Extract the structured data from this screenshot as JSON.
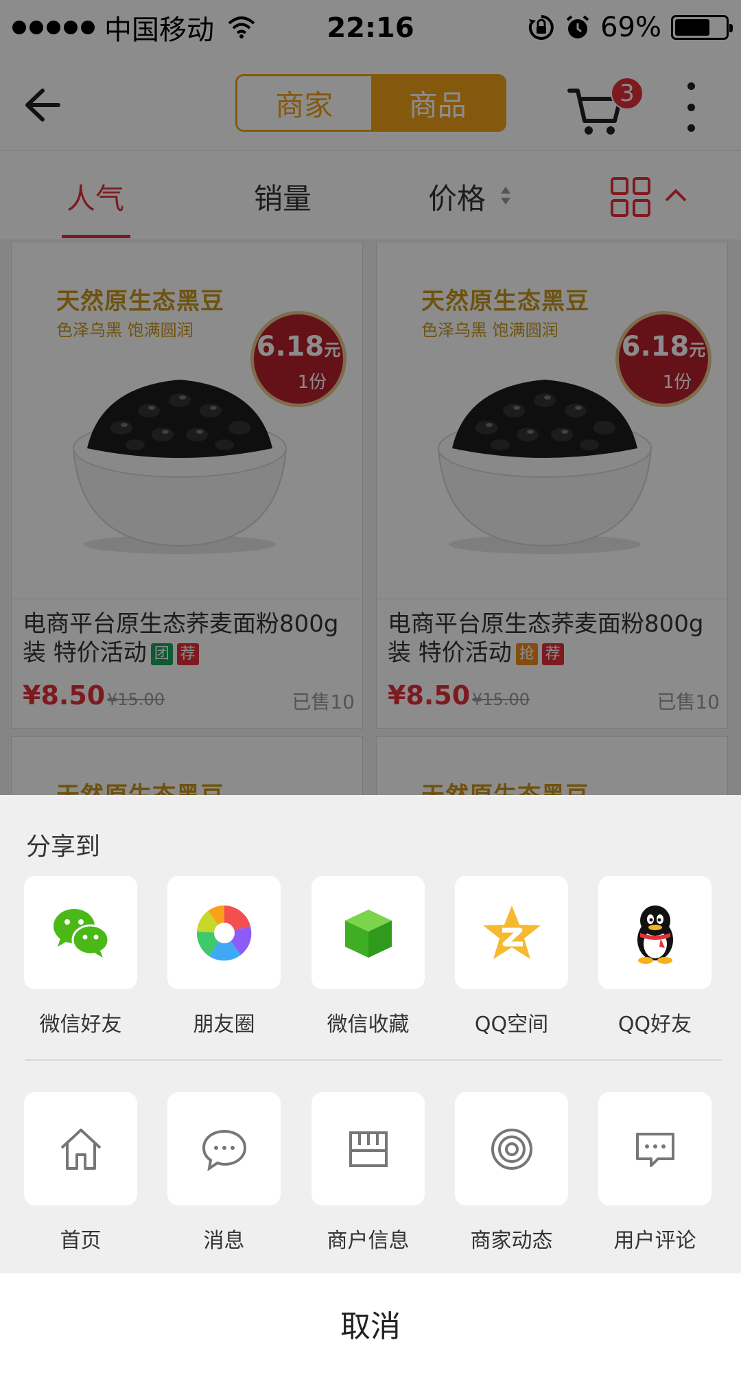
{
  "status_bar": {
    "carrier": "中国移动",
    "time": "22:16",
    "battery_percent": "69%",
    "battery_level": 0.69,
    "icons": [
      "signal-icon",
      "wifi-icon",
      "rotation-lock-icon",
      "alarm-icon",
      "battery-icon"
    ]
  },
  "navbar": {
    "segments": [
      "商家",
      "商品"
    ],
    "selected_segment": "商品",
    "cart_count": "3",
    "accent": "#f0a31a"
  },
  "sort_bar": {
    "items": [
      "人气",
      "销量",
      "价格"
    ],
    "active": "人气",
    "active_color": "#e4303b"
  },
  "products": [
    {
      "ad_title": "天然原生态黑豆",
      "ad_subtitle": "色泽乌黑  饱满圆润",
      "ad_price": "6.18",
      "ad_price_unit": "元",
      "ad_qty": "1份",
      "title": "电商平台原生态荞麦面粉800g装  特价活动",
      "tags": [
        {
          "text": "团",
          "color": "#1aa45c"
        },
        {
          "text": "荐",
          "color": "#e4303b"
        }
      ],
      "price": "¥8.50",
      "old_price": "¥15.00",
      "sold": "已售10"
    },
    {
      "ad_title": "天然原生态黑豆",
      "ad_subtitle": "色泽乌黑  饱满圆润",
      "ad_price": "6.18",
      "ad_price_unit": "元",
      "ad_qty": "1份",
      "title": "电商平台原生态荞麦面粉800g装  特价活动",
      "tags": [
        {
          "text": "抢",
          "color": "#f08a1c"
        },
        {
          "text": "荐",
          "color": "#e4303b"
        }
      ],
      "price": "¥8.50",
      "old_price": "¥15.00",
      "sold": "已售10"
    },
    {
      "ad_title": "天然原生态黑豆"
    },
    {
      "ad_title": "天然原生态黑豆"
    }
  ],
  "share_sheet": {
    "title": "分享到",
    "share_targets": [
      {
        "label": "微信好友",
        "icon": "wechat-icon"
      },
      {
        "label": "朋友圈",
        "icon": "moments-icon"
      },
      {
        "label": "微信收藏",
        "icon": "wechat-favorites-icon"
      },
      {
        "label": "QQ空间",
        "icon": "qzone-icon"
      },
      {
        "label": "QQ好友",
        "icon": "qq-icon"
      }
    ],
    "operations": [
      {
        "label": "首页",
        "icon": "home-icon"
      },
      {
        "label": "消息",
        "icon": "message-icon"
      },
      {
        "label": "商户信息",
        "icon": "store-icon"
      },
      {
        "label": "商家动态",
        "icon": "target-icon"
      },
      {
        "label": "用户评论",
        "icon": "comment-icon"
      }
    ],
    "cancel_label": "取消"
  }
}
